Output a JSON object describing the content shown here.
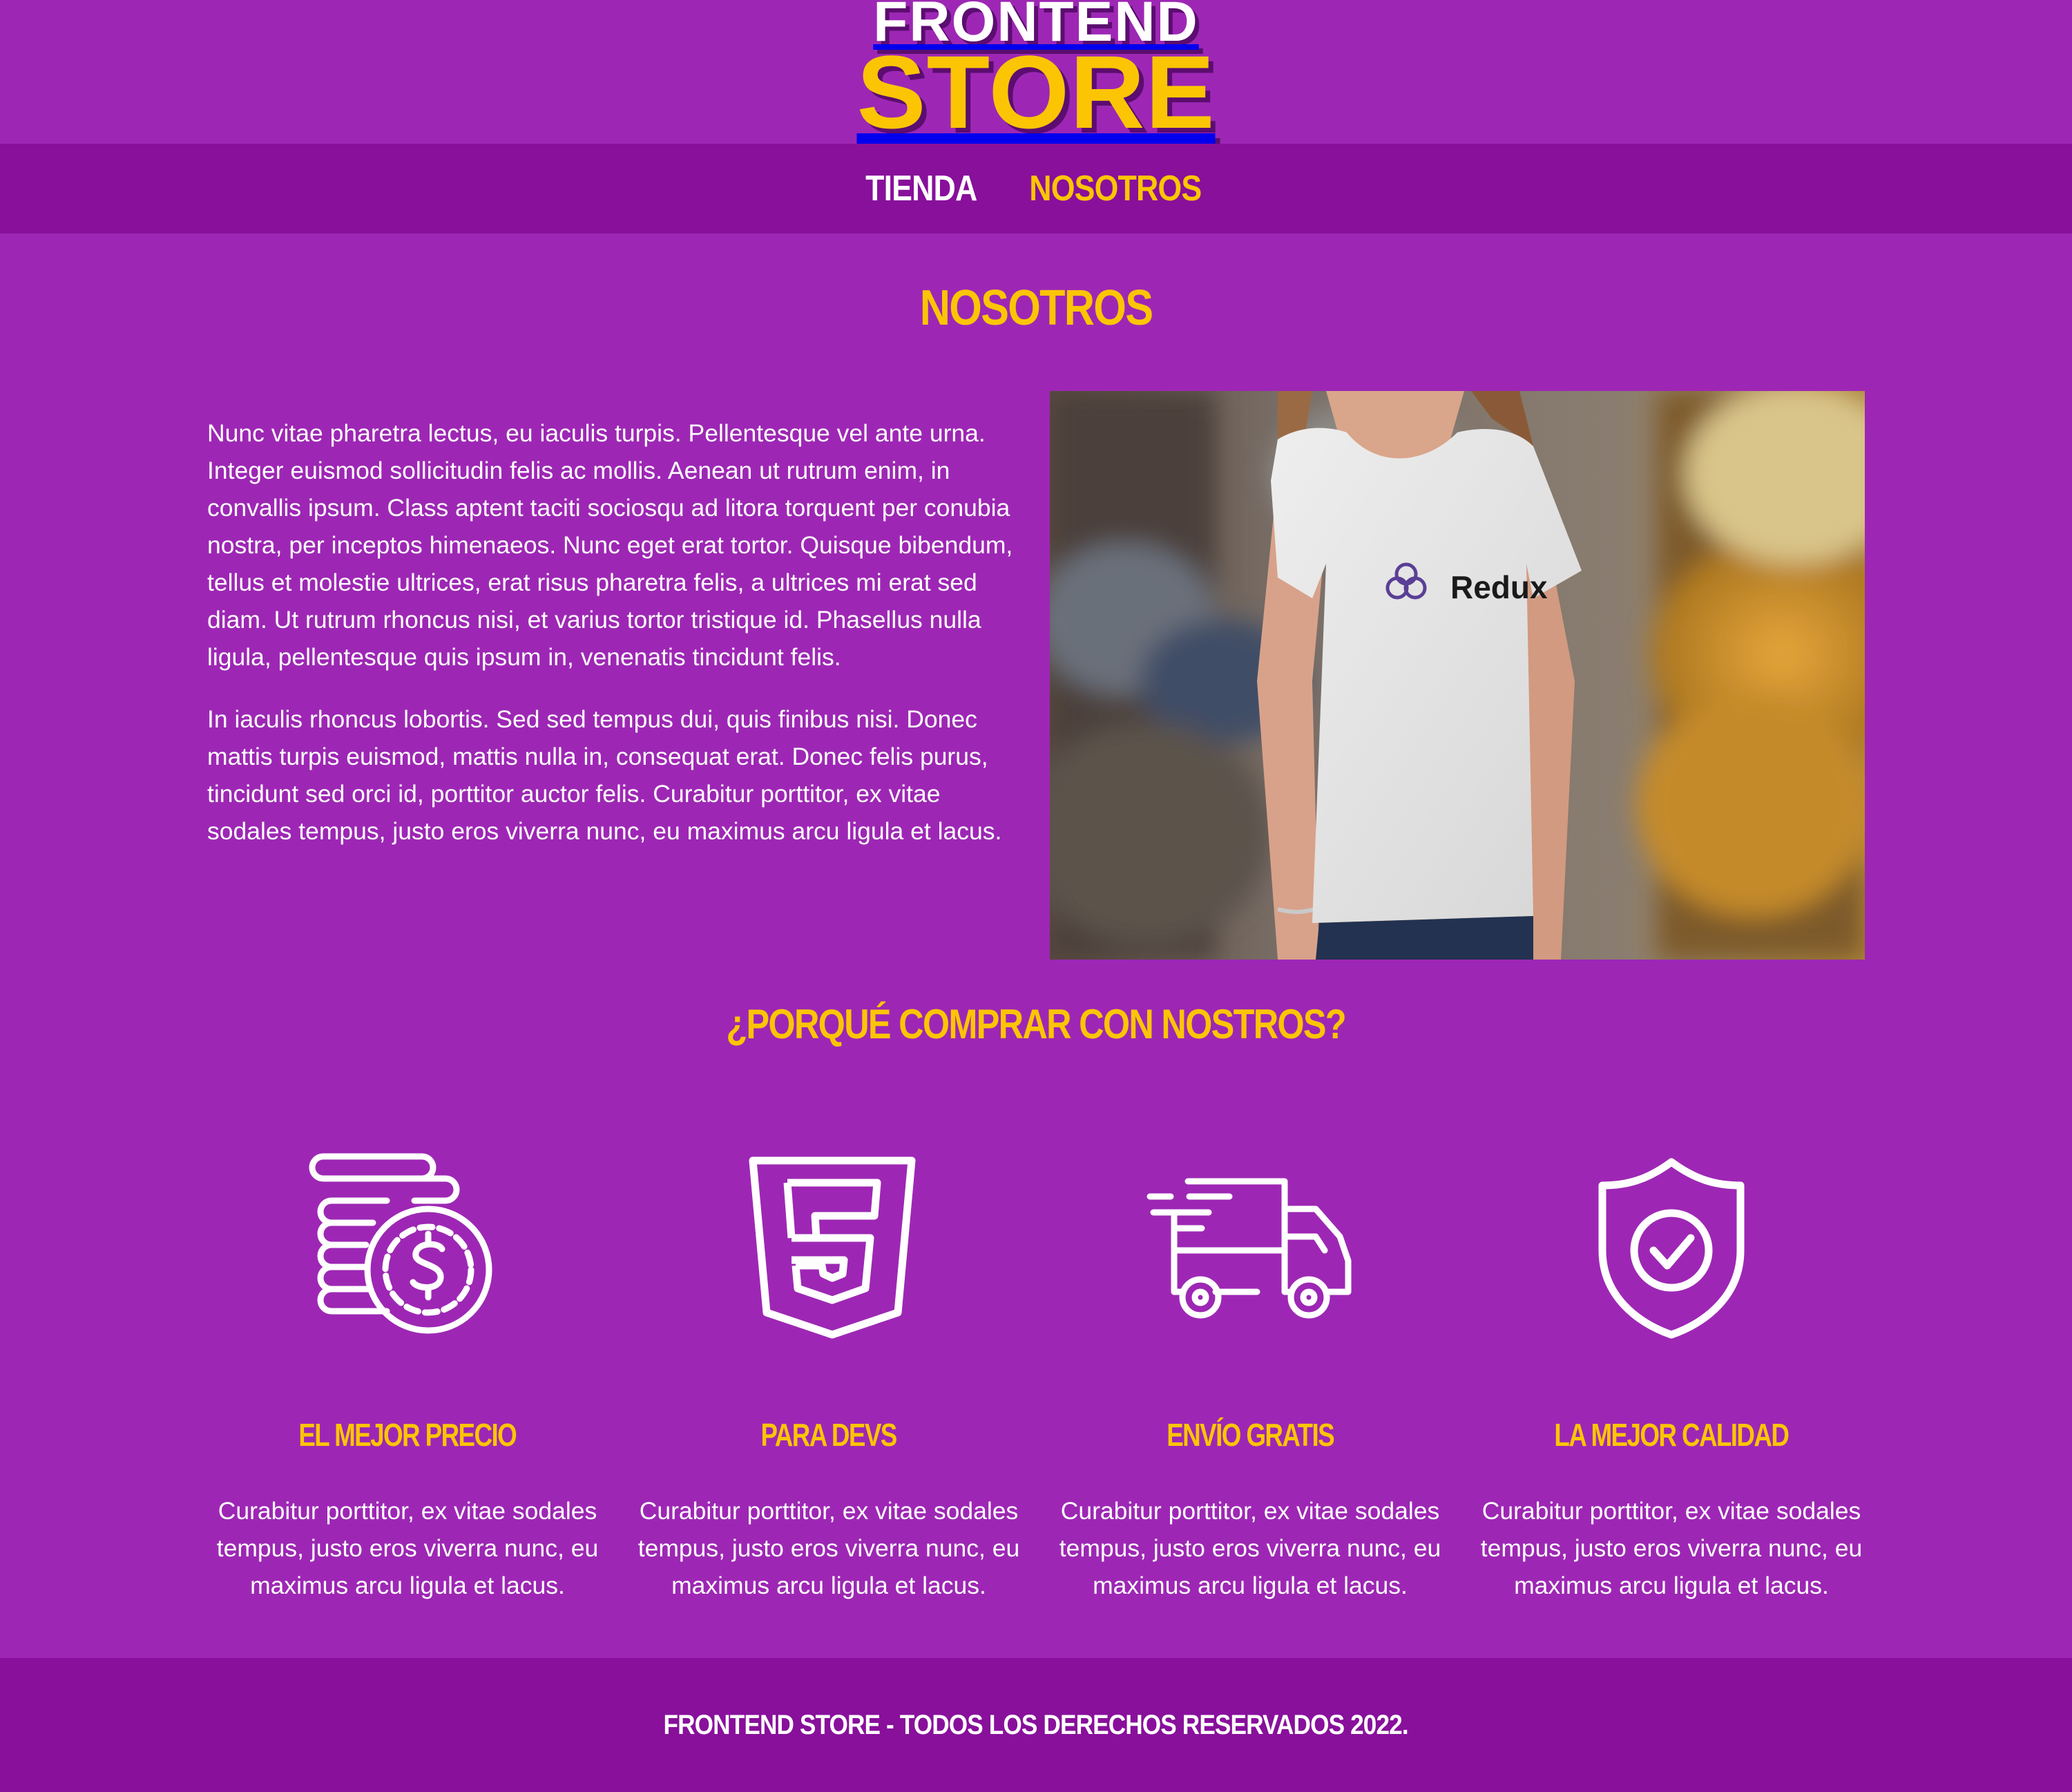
{
  "header": {
    "logo_line1": "FRONTEND",
    "logo_line2": "STORE"
  },
  "nav": {
    "items": [
      {
        "label": "Tienda",
        "active": false
      },
      {
        "label": "Nosotros",
        "active": true
      }
    ]
  },
  "about": {
    "title": "Nosotros",
    "paragraphs": [
      "Nunc vitae pharetra lectus, eu iaculis turpis. Pellentesque vel ante urna. Integer euismod sollicitudin felis ac mollis. Aenean ut rutrum enim, in convallis ipsum. Class aptent taciti sociosqu ad litora torquent per conubia nostra, per inceptos himenaeos. Nunc eget erat tortor. Quisque bibendum, tellus et molestie ultrices, erat risus pharetra felis, a ultrices mi erat sed diam. Ut rutrum rhoncus nisi, et varius tortor tristique id. Phasellus nulla ligula, pellentesque quis ipsum in, venenatis tincidunt felis.",
      "In iaculis rhoncus lobortis. Sed sed tempus dui, quis finibus nisi. Donec mattis turpis euismod, mattis nulla in, consequat erat. Donec felis purus, tincidunt sed orci id, porttitor auctor felis. Curabitur porttitor, ex vitae sodales tempus, justo eros viverra nunc, eu maximus arcu ligula et lacus."
    ],
    "image_shirt_text": "Redux"
  },
  "why": {
    "title": "¿Porqué comprar con nostros?",
    "features": [
      {
        "icon": "coins-dollar-icon",
        "title": "El mejor precio",
        "description": "Curabitur porttitor, ex vitae sodales tempus, justo eros viverra nunc, eu maximus arcu ligula et lacus."
      },
      {
        "icon": "html5-icon",
        "title": "Para devs",
        "description": "Curabitur porttitor, ex vitae sodales tempus, justo eros viverra nunc, eu maximus arcu ligula et lacus."
      },
      {
        "icon": "delivery-truck-icon",
        "title": "Envío gratis",
        "description": "Curabitur porttitor, ex vitae sodales tempus, justo eros viverra nunc, eu maximus arcu ligula et lacus."
      },
      {
        "icon": "shield-check-icon",
        "title": "La mejor calidad",
        "description": "Curabitur porttitor, ex vitae sodales tempus, justo eros viverra nunc, eu maximus arcu ligula et lacus."
      }
    ]
  },
  "footer": {
    "text": "Frontend Store - Todos los derechos reservados 2022."
  },
  "colors": {
    "background": "#9d27b4",
    "nav_footer": "#88109b",
    "accent": "#fbc504",
    "text": "#ffffff"
  }
}
